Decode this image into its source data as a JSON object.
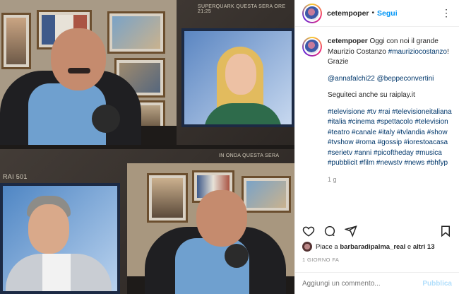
{
  "tv_overlay": {
    "top_text": "Superquark questa sera ore 21:25",
    "bottom_text": "In onda questa sera",
    "channel": "1",
    "bottom_left": "RAI 501"
  },
  "post": {
    "username": "cetempoper",
    "follow_label": "Segui",
    "more_icon": "more-dots-icon",
    "caption": {
      "intro": "Oggi con noi il grande Maurizio Costanzo",
      "intro_tag": "#mauriziocostanzo",
      "intro_end": "! Grazie",
      "mentions": "@annafalchi22 @beppeconvertini",
      "follow_text": "Seguiteci anche su raiplay.it",
      "hashtags": "#televisione #tv #rai #televisioneitaliana #italia #cinema #spettacolo #television #teatro #canale #italy #tvlandia #show #tvshow #roma #gossip #iorestoacasa #serietv #anni #picoftheday #musica #pubblicit #film #newstv #news #bhfyp",
      "age": "1 g"
    },
    "likes_prefix": "Piace a",
    "likes_user": "barbaradipalma_real",
    "likes_and": "e",
    "likes_others": "altri 13",
    "date": "1 GIORNO FA",
    "comment_placeholder": "Aggiungi un commento...",
    "publish_label": "Pubblica"
  },
  "colors": {
    "link_blue": "#0095f6",
    "hashtag": "#00376b",
    "muted": "#8e8e8e",
    "publish_disabled": "#b2dffc"
  }
}
